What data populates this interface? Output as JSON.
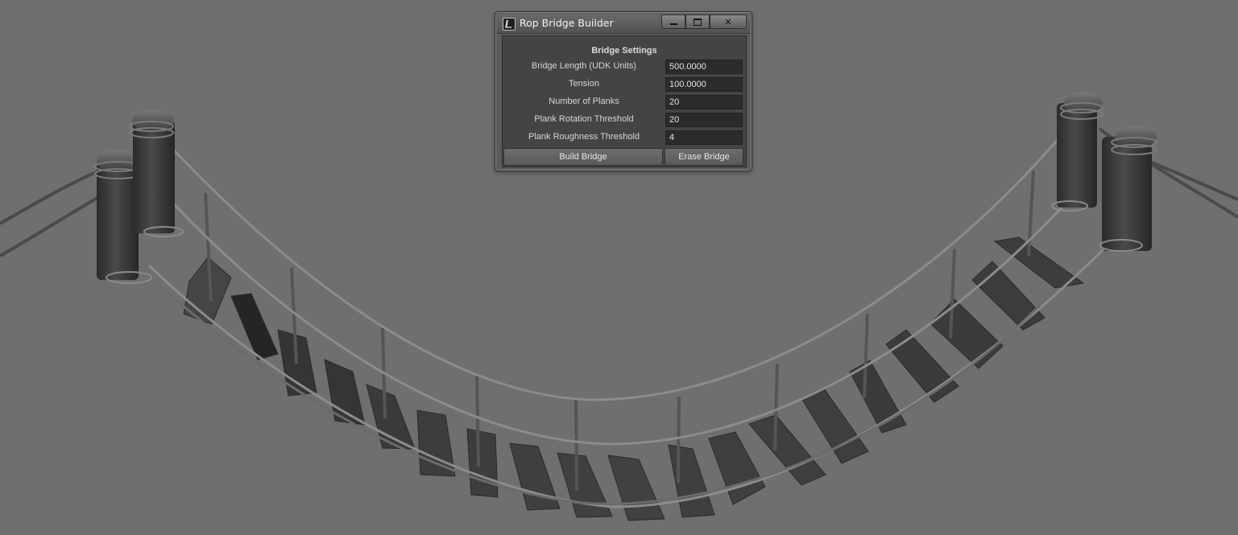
{
  "window": {
    "title": "Rop Bridge Builder",
    "icons": {
      "app": "maya-app-icon",
      "minimize": "minimize-icon",
      "maximize": "maximize-icon",
      "close": "close-icon"
    },
    "close_glyph": "✕"
  },
  "panel": {
    "heading": "Bridge Settings",
    "fields": [
      {
        "label": "Bridge Length (UDK Units)",
        "value": "500.0000"
      },
      {
        "label": "Tension",
        "value": "100.0000"
      },
      {
        "label": "Number of Planks",
        "value": "20"
      },
      {
        "label": "Plank Rotation Threshold",
        "value": "20"
      },
      {
        "label": "Plank Roughness Threshold",
        "value": "4"
      }
    ],
    "buttons": {
      "build": "Build Bridge",
      "erase": "Erase Bridge"
    }
  },
  "scene": {
    "background": "#6f6f6f",
    "post_color": "#3c3c3c",
    "plank_color": "#3a3a3a",
    "rope_color": "#8a8a8a"
  }
}
